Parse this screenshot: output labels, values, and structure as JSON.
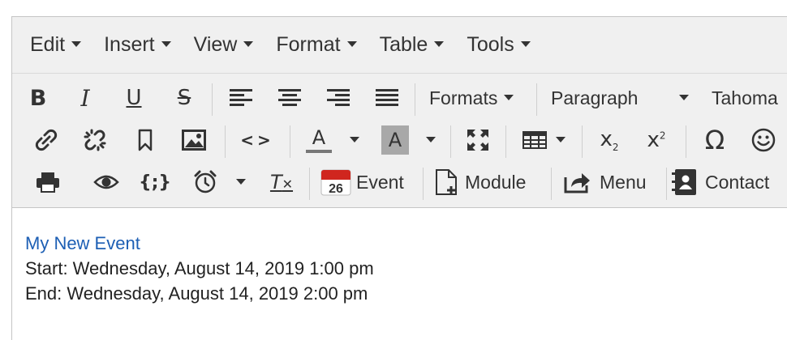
{
  "menubar": {
    "items": [
      {
        "label": "Edit"
      },
      {
        "label": "Insert"
      },
      {
        "label": "View"
      },
      {
        "label": "Format"
      },
      {
        "label": "Table"
      },
      {
        "label": "Tools"
      }
    ]
  },
  "toolbar": {
    "formats_label": "Formats",
    "block_format_value": "Paragraph",
    "font_family_value": "Tahoma",
    "event_label": "Event",
    "event_icon_day": "26",
    "module_label": "Module",
    "menu_label": "Menu",
    "contact_label": "Contact",
    "omega_glyph": "Ω",
    "code_glyph": "<>",
    "braces_glyph": "{;}",
    "textcolor_letter": "A",
    "bgcolor_letter": "A",
    "bold_letter": "B",
    "italic_letter": "I",
    "underline_letter": "U",
    "strike_letter": "S",
    "clearformat_letter": "T",
    "subscript_letter": "x",
    "subscript_index": "2",
    "superscript_letter": "x",
    "superscript_index": "2"
  },
  "content": {
    "link_text": "My New Event",
    "start_line": "Start: Wednesday, August 14, 2019 1:00 pm",
    "end_line": "End: Wednesday, August 14, 2019 2:00 pm"
  },
  "colors": {
    "toolbar_bg": "#f0f0f0",
    "link": "#1d5fb4",
    "text": "#333333",
    "event_icon_red": "#d0261e"
  }
}
